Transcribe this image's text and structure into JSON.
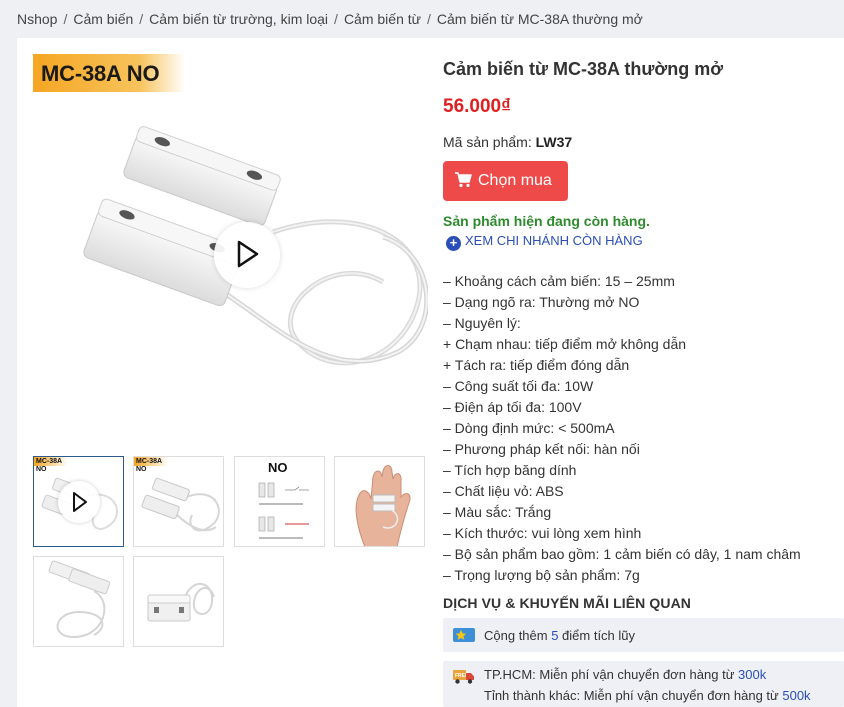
{
  "breadcrumb": [
    "Nshop",
    "Cảm biến",
    "Cảm biến từ trường, kim loại",
    "Cảm biến từ",
    "Cảm biến từ MC-38A thường mở"
  ],
  "gallery": {
    "badge": "MC-38A NO",
    "thumb_badge": "MC-38A NO",
    "thumb3_label": "NO"
  },
  "product": {
    "title": "Cảm biến từ MC-38A thường mở",
    "price": "56.000₫",
    "sku_label": "Mã sản phẩm:",
    "sku": "LW37",
    "buy_label": "Chọn mua",
    "stock": "Sản phẩm hiện đang còn hàng.",
    "branch_link": "XEM CHI NHÁNH CÒN HÀNG"
  },
  "specs": [
    "– Khoảng cách cảm biến: 15 – 25mm",
    "– Dạng ngõ ra: Thường mở NO",
    "– Nguyên lý:",
    "+ Chạm nhau: tiếp điểm mở không dẫn",
    "+ Tách ra: tiếp điểm đóng dẫn",
    "– Công suất tối đa: 10W",
    "– Điện áp tối đa: 100V",
    "– Dòng định mức: < 500mA",
    "– Phương pháp kết nối: hàn nối",
    "– Tích hợp băng dính",
    "– Chất liệu vỏ: ABS",
    "– Màu sắc: Trắng",
    "– Kích thước: vui lòng xem hình",
    "– Bộ sản phẩm bao gồm: 1 cảm biến có dây, 1 nam châm",
    "– Trọng lượng bộ sản phẩm: 7g"
  ],
  "services": {
    "title": "DỊCH VỤ & KHUYẾN MÃI LIÊN QUAN",
    "points_prefix": "Cộng thêm ",
    "points_value": "5",
    "points_suffix": " điểm tích lũy",
    "ship_hcm_prefix": "TP.HCM: Miễn phí vận chuyển đơn hàng từ ",
    "ship_hcm_value": "300k",
    "ship_other_prefix": "Tỉnh thành khác: Miễn phí vận chuyển đơn hàng từ ",
    "ship_other_value": "500k"
  },
  "colors": {
    "price": "#e02020",
    "buy_button": "#ef4a4a",
    "stock": "#2e8b2e",
    "link": "#2b4fb8",
    "badge": "#f5a623"
  }
}
